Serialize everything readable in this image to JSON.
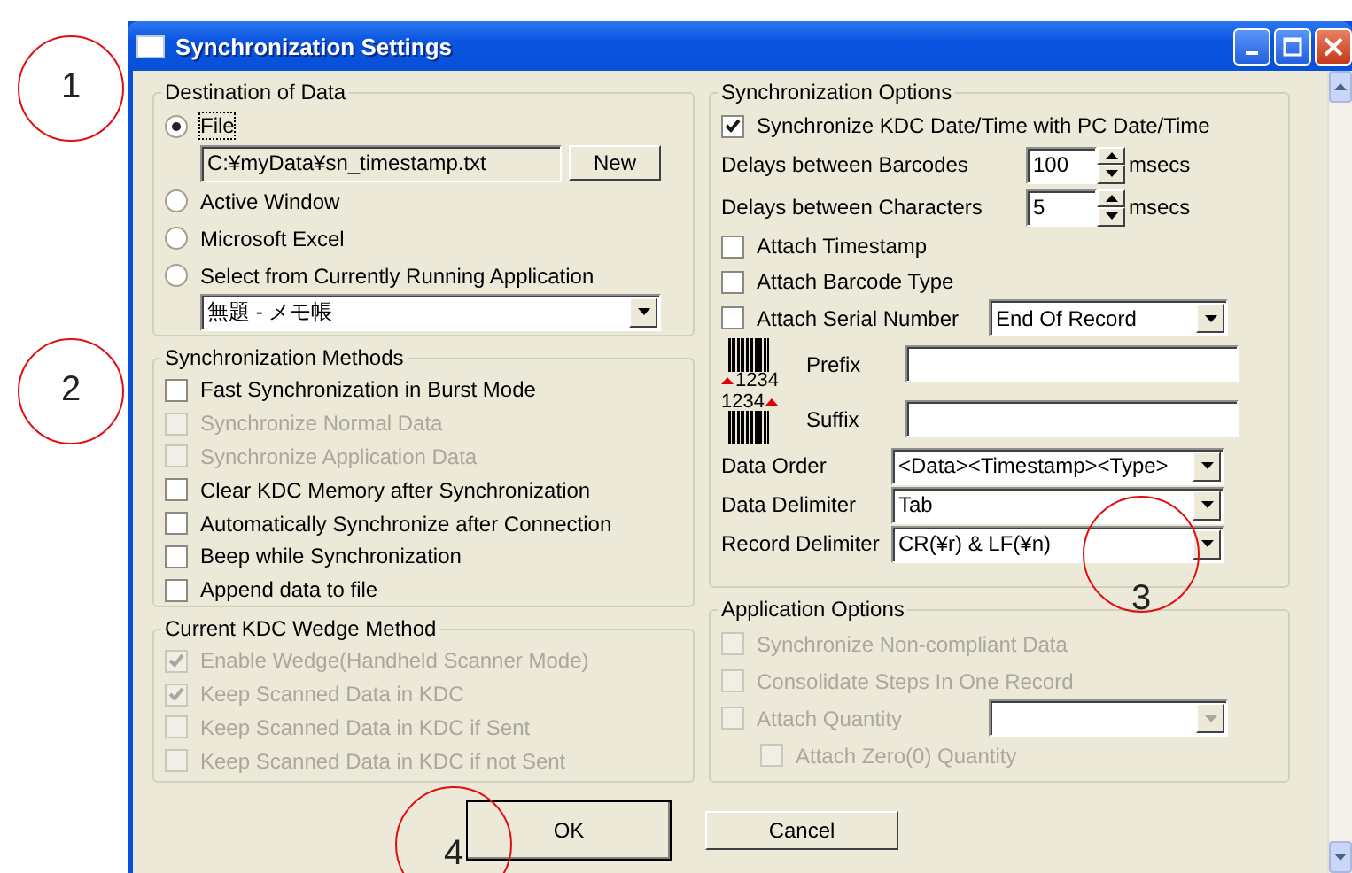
{
  "window": {
    "title": "Synchronization Settings",
    "controls": [
      {
        "kind": "minimize"
      },
      {
        "kind": "maximize"
      },
      {
        "kind": "close"
      }
    ]
  },
  "destination": {
    "title": "Destination of Data",
    "options": [
      {
        "label": "File",
        "selected": true
      },
      {
        "label": "Active Window",
        "selected": false
      },
      {
        "label": "Microsoft Excel",
        "selected": false
      },
      {
        "label": "Select from Currently Running Application",
        "selected": false
      }
    ],
    "file_path": "C:¥myData¥sn_timestamp.txt",
    "new_button": "New",
    "application": "無題 - メモ帳"
  },
  "methods": {
    "title": "Synchronization Methods",
    "items": [
      {
        "label": "Fast Synchronization in Burst Mode",
        "checked": false,
        "disabled": false
      },
      {
        "label": "Synchronize Normal Data",
        "checked": false,
        "disabled": true
      },
      {
        "label": "Synchronize Application Data",
        "checked": false,
        "disabled": true
      },
      {
        "label": "Clear KDC Memory after Synchronization",
        "checked": false,
        "disabled": false
      },
      {
        "label": "Automatically Synchronize after Connection",
        "checked": false,
        "disabled": false
      },
      {
        "label": "Beep while Synchronization",
        "checked": false,
        "disabled": false
      },
      {
        "label": "Append data to file",
        "checked": false,
        "disabled": false
      }
    ]
  },
  "wedge": {
    "title": "Current KDC Wedge Method",
    "items": [
      {
        "label": "Enable Wedge(Handheld Scanner Mode)",
        "checked": true,
        "disabled": true
      },
      {
        "label": "Keep Scanned Data in KDC",
        "checked": true,
        "disabled": true
      },
      {
        "label": "Keep Scanned Data in KDC if Sent",
        "checked": false,
        "disabled": true
      },
      {
        "label": "Keep Scanned Data in KDC if not Sent",
        "checked": false,
        "disabled": true
      }
    ]
  },
  "sync_options": {
    "title": "Synchronization Options",
    "rows": [
      {
        "kind": "checkbox",
        "label": "Synchronize KDC Date/Time with PC Date/Time",
        "checked": true
      },
      {
        "kind": "spin",
        "label": "Delays between Barcodes",
        "value": "100",
        "unit": "msecs"
      },
      {
        "kind": "spin",
        "label": "Delays between Characters",
        "value": "5",
        "unit": "msecs"
      },
      {
        "kind": "checkbox",
        "label": "Attach Timestamp",
        "checked": false
      },
      {
        "kind": "checkbox",
        "label": "Attach Barcode Type",
        "checked": false
      },
      {
        "kind": "checkbox_select",
        "label": "Attach Serial Number",
        "checked": false,
        "value": "End Of Record"
      },
      {
        "kind": "barcode_start",
        "label": "Prefix",
        "digits": "1234"
      },
      {
        "kind": "barcode_end",
        "label": "Suffix",
        "digits": "1234"
      },
      {
        "kind": "select",
        "label": "Data Order",
        "value": "<Data><Timestamp><Type>"
      },
      {
        "kind": "select",
        "label": "Data Delimiter",
        "value": "Tab"
      },
      {
        "kind": "select",
        "label": "Record Delimiter",
        "value": "CR(¥r) & LF(¥n)"
      }
    ]
  },
  "app_options": {
    "title": "Application Options",
    "items": [
      {
        "kind": "checkbox",
        "label": "Synchronize Non-compliant Data",
        "checked": false,
        "disabled": true
      },
      {
        "kind": "checkbox",
        "label": "Consolidate Steps In One Record",
        "checked": false,
        "disabled": true
      },
      {
        "kind": "checkbox_select",
        "label": "Attach Quantity",
        "checked": false,
        "disabled": true,
        "children": [
          {
            "kind": "checkbox",
            "label": "Attach Zero(0) Quantity",
            "checked": false,
            "disabled": true
          }
        ]
      }
    ]
  },
  "buttons": [
    {
      "label": "OK",
      "default": true
    },
    {
      "label": "Cancel",
      "default": false
    }
  ],
  "annotations": [
    {
      "label": "1"
    },
    {
      "label": "2"
    },
    {
      "label": "3"
    },
    {
      "label": "4"
    }
  ]
}
